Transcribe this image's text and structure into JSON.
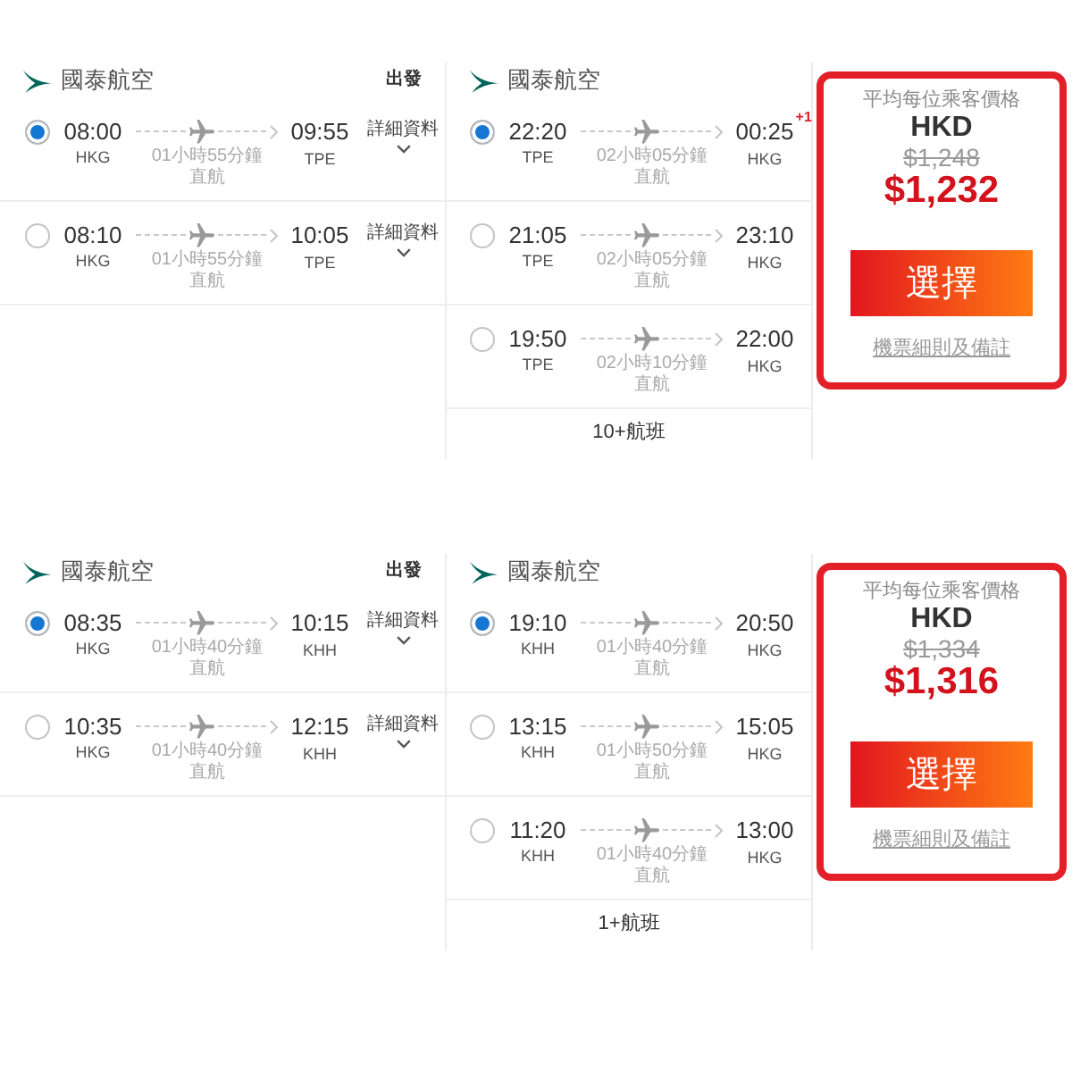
{
  "panels": [
    {
      "legs": [
        {
          "airline": "國泰航空",
          "direction_label": "出發",
          "flights": [
            {
              "selected": true,
              "depart_time": "08:00",
              "depart_airport": "HKG",
              "duration": "01小時55分鐘",
              "stops": "直航",
              "arrive_time": "09:55",
              "arrive_airport": "TPE",
              "details_link": "詳細資料"
            },
            {
              "selected": false,
              "depart_time": "08:10",
              "depart_airport": "HKG",
              "duration": "01小時55分鐘",
              "stops": "直航",
              "arrive_time": "10:05",
              "arrive_airport": "TPE",
              "details_link": "詳細資料"
            }
          ]
        },
        {
          "airline": "國泰航空",
          "flights": [
            {
              "selected": true,
              "depart_time": "22:20",
              "depart_airport": "TPE",
              "duration": "02小時05分鐘",
              "stops": "直航",
              "arrive_time": "00:25",
              "day_offset": "+1",
              "arrive_airport": "HKG"
            },
            {
              "selected": false,
              "depart_time": "21:05",
              "depart_airport": "TPE",
              "duration": "02小時05分鐘",
              "stops": "直航",
              "arrive_time": "23:10",
              "arrive_airport": "HKG"
            },
            {
              "selected": false,
              "depart_time": "19:50",
              "depart_airport": "TPE",
              "duration": "02小時10分鐘",
              "stops": "直航",
              "arrive_time": "22:00",
              "arrive_airport": "HKG"
            }
          ],
          "more_flights": "10+航班"
        }
      ],
      "price": {
        "label": "平均每位乘客價格",
        "currency": "HKD",
        "original_price": "$1,248",
        "price": "$1,232",
        "select_button": "選擇",
        "terms_link": "機票細則及備註"
      }
    },
    {
      "legs": [
        {
          "airline": "國泰航空",
          "direction_label": "出發",
          "flights": [
            {
              "selected": true,
              "depart_time": "08:35",
              "depart_airport": "HKG",
              "duration": "01小時40分鐘",
              "stops": "直航",
              "arrive_time": "10:15",
              "arrive_airport": "KHH",
              "details_link": "詳細資料"
            },
            {
              "selected": false,
              "depart_time": "10:35",
              "depart_airport": "HKG",
              "duration": "01小時40分鐘",
              "stops": "直航",
              "arrive_time": "12:15",
              "arrive_airport": "KHH",
              "details_link": "詳細資料"
            }
          ]
        },
        {
          "airline": "國泰航空",
          "flights": [
            {
              "selected": true,
              "depart_time": "19:10",
              "depart_airport": "KHH",
              "duration": "01小時40分鐘",
              "stops": "直航",
              "arrive_time": "20:50",
              "arrive_airport": "HKG"
            },
            {
              "selected": false,
              "depart_time": "13:15",
              "depart_airport": "KHH",
              "duration": "01小時50分鐘",
              "stops": "直航",
              "arrive_time": "15:05",
              "arrive_airport": "HKG"
            },
            {
              "selected": false,
              "depart_time": "11:20",
              "depart_airport": "KHH",
              "duration": "01小時40分鐘",
              "stops": "直航",
              "arrive_time": "13:00",
              "arrive_airport": "HKG"
            }
          ],
          "more_flights": "1+航班"
        }
      ],
      "price": {
        "label": "平均每位乘客價格",
        "currency": "HKD",
        "original_price": "$1,334",
        "price": "$1,316",
        "select_button": "選擇",
        "terms_link": "機票細則及備註"
      }
    }
  ]
}
